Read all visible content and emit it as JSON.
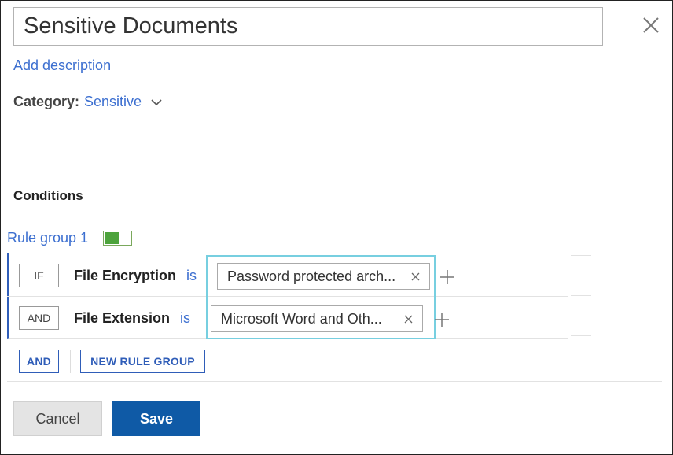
{
  "dialog": {
    "title": "Sensitive Documents",
    "add_description": "Add description"
  },
  "category": {
    "label": "Category:",
    "value": "Sensitive"
  },
  "conditions": {
    "title": "Conditions",
    "rule_group": {
      "label": "Rule group 1",
      "enabled": true,
      "rules": [
        {
          "operator": "IF",
          "field": "File Encryption",
          "comparator": "is",
          "value": "Password protected arch..."
        },
        {
          "operator": "AND",
          "field": "File Extension",
          "comparator": "is",
          "value": "Microsoft Word and Oth..."
        }
      ]
    },
    "add_and_label": "AND",
    "new_rule_group_label": "NEW RULE GROUP"
  },
  "footer": {
    "cancel_label": "Cancel",
    "save_label": "Save"
  },
  "colors": {
    "link": "#3c6fd0",
    "accent": "#2f5db8",
    "save": "#0f5aa6",
    "toggle_on": "#4da33c",
    "highlight": "#77cfe0"
  }
}
